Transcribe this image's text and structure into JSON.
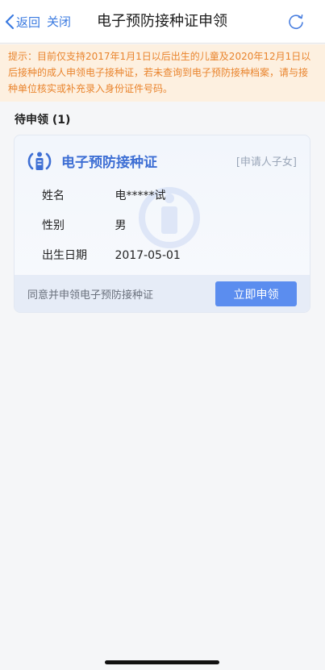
{
  "nav": {
    "back_label": "返回",
    "close_label": "关闭",
    "title": "电子预防接种证申领"
  },
  "notice": {
    "text": "提示：目前仅支持2017年1月1日以后出生的儿童及2020年12月1日以后接种的成人申领电子接种证，若未查询到电子预防接种档案，请与接种单位核实或补充录入身份证件号码。"
  },
  "section": {
    "title": "待申领 (1)"
  },
  "card": {
    "title": "电子预防接种证",
    "tag": "[申请人子女]",
    "fields": [
      {
        "label": "姓名",
        "value": "电*****试"
      },
      {
        "label": "性别",
        "value": "男"
      },
      {
        "label": "出生日期",
        "value": "2017-05-01"
      }
    ],
    "footer_text": "同意并申领电子预防接种证",
    "button_label": "立即申领"
  },
  "colors": {
    "accent": "#3a7ae0",
    "notice_text": "#e9842d",
    "notice_bg": "#fdf0e0",
    "card_title": "#3e6fd4",
    "button_bg": "#5b8def"
  },
  "icons": {
    "back": "chevron-left-icon",
    "refresh": "refresh-icon",
    "logo": "vaccination-logo-icon"
  }
}
